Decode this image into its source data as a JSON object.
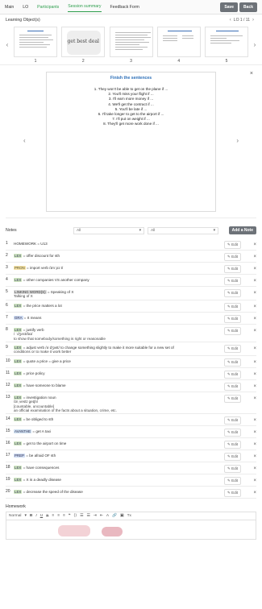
{
  "nav": {
    "tabs": [
      "Main",
      "LO",
      "Participants",
      "Session summary",
      "Feedback Form"
    ],
    "save": "Save",
    "back": "Back"
  },
  "lo": {
    "title": "Learning Object(s)",
    "pager": "LO 1 / 11",
    "thumbs": [
      "1",
      "2",
      "3",
      "4",
      "5"
    ],
    "thumb2_text": "get best deal"
  },
  "viewer": {
    "title": "Finish the sentences",
    "lines": [
      "1. They won't be able to get on the plane if ...",
      "2. You'll miss your flight if ...",
      "3. I'll earn more money if ...",
      "4. We'll get the contract if ...",
      "5. You'll be late if ...",
      "6. I'll take longer to get to the airport if ...",
      "7. I'll put on weight if ...",
      "8. They'll get more work done if ..."
    ]
  },
  "notes_bar": {
    "label": "Notes",
    "filter1": "All",
    "filter2": "All",
    "add": "Add a Note"
  },
  "notes": [
    {
      "n": "1",
      "tag": "",
      "text": "HOMEWORK = U13",
      "extra": ""
    },
    {
      "n": "2",
      "tag": "LEX",
      "text": " = offer discount for sth",
      "extra": ""
    },
    {
      "n": "3",
      "tag": "PRON",
      "text": " = import verb /ɪmˈpɔːt/",
      "extra": ""
    },
    {
      "n": "4",
      "tag": "LEX",
      "text": " = other companies VS another company",
      "extra": ""
    },
    {
      "n": "5",
      "tag": "LINKING WORD(S)",
      "text": " = Speaking of X",
      "extra": "Talking of X"
    },
    {
      "n": "6",
      "tag": "LEX",
      "text": " = the price matters a lot",
      "extra": ""
    },
    {
      "n": "7",
      "tag": "GRA",
      "text": " = It means",
      "extra": ""
    },
    {
      "n": "8",
      "tag": "LEX",
      "text": " = justify verb",
      "extra": "/ ˈdʒʌstɪfaɪ/\nto show that somebody/something is right or reasonable"
    },
    {
      "n": "9",
      "tag": "LEX",
      "text": " = adjust verb /əˈdʒʌst/ to change something slightly to make it more suitable for a new set of",
      "extra": "conditions or to make it work better"
    },
    {
      "n": "10",
      "tag": "LEX",
      "text": " = quote a price = give a price",
      "extra": ""
    },
    {
      "n": "11",
      "tag": "LEX",
      "text": " = price policy",
      "extra": ""
    },
    {
      "n": "12",
      "tag": "LEX",
      "text": " = have someone to blame",
      "extra": ""
    },
    {
      "n": "13",
      "tag": "LEX",
      "text": " = investigation noun",
      "extra": "/ɪnˌvestɪˈɡeɪʃn/\n[countable, uncountable]\nan official examination of the facts about a situation, crime, etc."
    },
    {
      "n": "14",
      "tag": "LEX",
      "text": " = be obliged to sth",
      "extra": ""
    },
    {
      "n": "15",
      "tag": "AVANTHE",
      "text": " = get A taxi",
      "extra": ""
    },
    {
      "n": "16",
      "tag": "LEX",
      "text": " = get to the airport on time",
      "extra": ""
    },
    {
      "n": "17",
      "tag": "PREP",
      "text": " = be afraid OF sth",
      "extra": ""
    },
    {
      "n": "18",
      "tag": "LEX",
      "text": " = have consequences",
      "extra": ""
    },
    {
      "n": "19",
      "tag": "LEX",
      "text": " = X is a deadly disease",
      "extra": ""
    },
    {
      "n": "20",
      "tag": "LEX",
      "text": " = decrease the speed of the disease",
      "extra": ""
    }
  ],
  "note_actions": {
    "edit": "Edit",
    "delete": "×"
  },
  "homework": {
    "title": "Homework",
    "toolbar_style": "Normal"
  },
  "colors": {
    "accent": "#2e9e4d",
    "button": "#6d7278",
    "link": "#2c6fb8"
  }
}
